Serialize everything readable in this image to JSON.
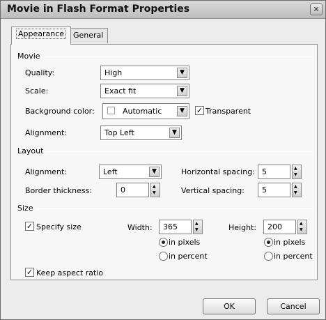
{
  "window": {
    "title": "Movie in Flash Format Properties",
    "close_glyph": "✕"
  },
  "tabs": [
    {
      "label": "Appearance"
    },
    {
      "label": "General"
    }
  ],
  "movie": {
    "section": "Movie",
    "quality_label": "Quality:",
    "quality_value": "High",
    "scale_label": "Scale:",
    "scale_value": "Exact fit",
    "bg_label": "Background color:",
    "bg_value": "Automatic",
    "transparent_label": "Transparent",
    "alignment_label": "Alignment:",
    "alignment_value": "Top Left"
  },
  "layout": {
    "section": "Layout",
    "alignment_label": "Alignment:",
    "alignment_value": "Left",
    "border_label": "Border thickness:",
    "border_value": "0",
    "hspacing_label": "Horizontal spacing:",
    "hspacing_value": "5",
    "vspacing_label": "Vertical spacing:",
    "vspacing_value": "5"
  },
  "size": {
    "section": "Size",
    "specify_label": "Specify size",
    "width_label": "Width:",
    "width_value": "365",
    "height_label": "Height:",
    "height_value": "200",
    "in_pixels": "in pixels",
    "in_percent": "in percent",
    "keep_aspect_label": "Keep aspect ratio"
  },
  "buttons": {
    "ok": "OK",
    "cancel": "Cancel"
  },
  "glyphs": {
    "check": "✓",
    "down_arrow": "▼",
    "up_triangle": "▲",
    "down_triangle": "▼"
  }
}
